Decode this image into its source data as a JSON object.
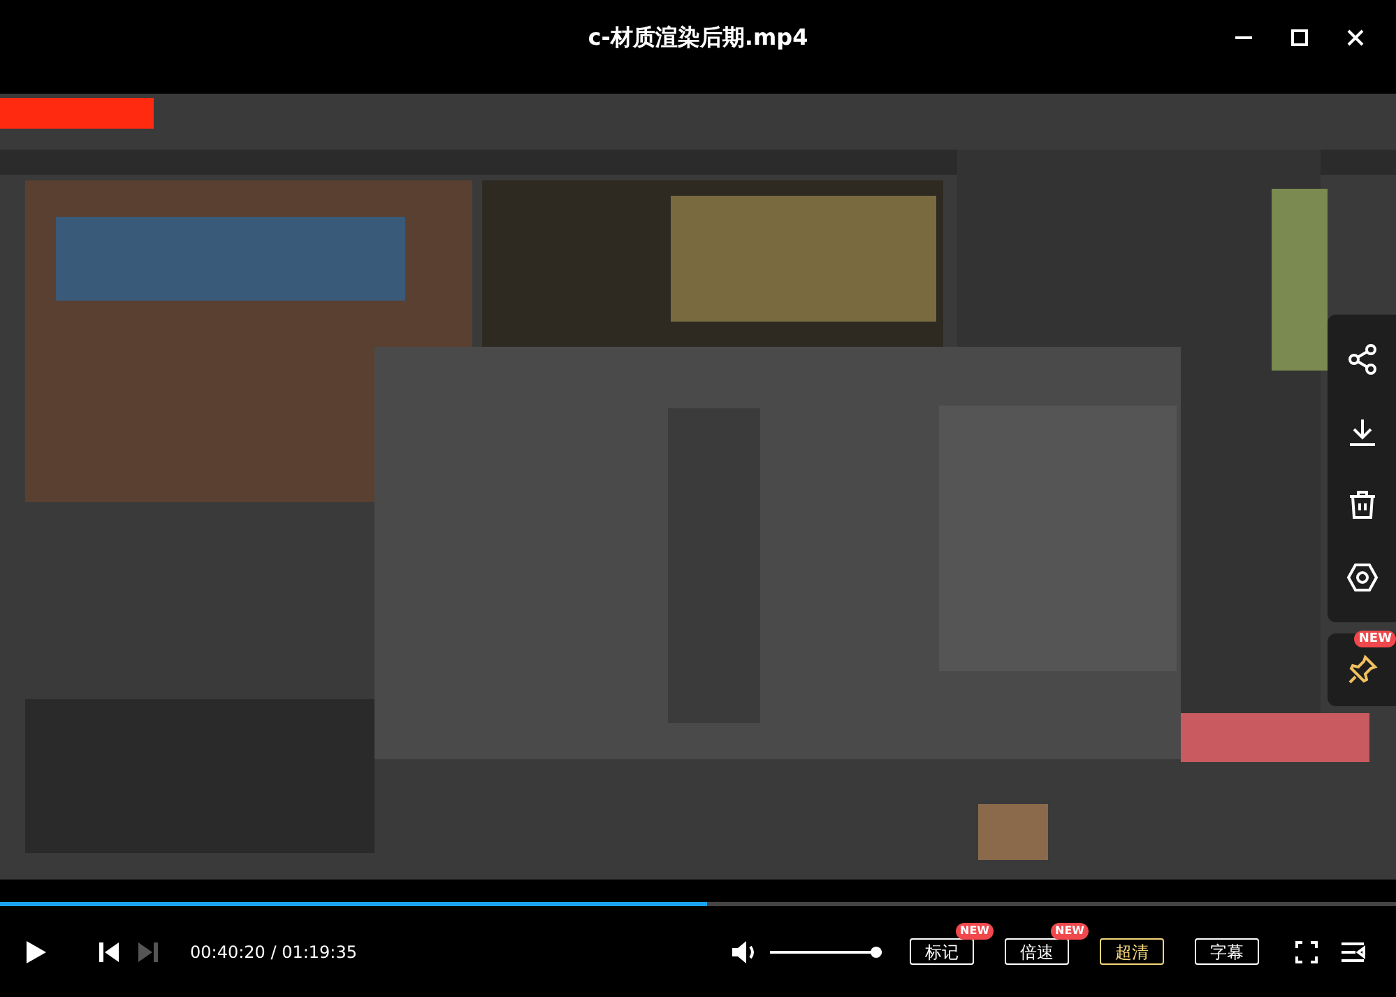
{
  "window": {
    "title": "c-材质渲染后期.mp4"
  },
  "side_actions": [
    {
      "kind": "share"
    },
    {
      "kind": "download"
    },
    {
      "kind": "delete"
    },
    {
      "kind": "ring"
    }
  ],
  "pin": {
    "badge": "NEW"
  },
  "progress": {
    "level": 0.507
  },
  "next": {
    "disabled": true
  },
  "time": "00:40:20 / 01:19:35",
  "volume": {
    "level": 1.0
  },
  "buttons": [
    {
      "label": "标记",
      "badge": "NEW",
      "selected": false
    },
    {
      "label": "倍速",
      "badge": "NEW",
      "selected": false
    },
    {
      "label": "超清",
      "selected": true
    },
    {
      "label": "字幕",
      "selected": false
    }
  ]
}
